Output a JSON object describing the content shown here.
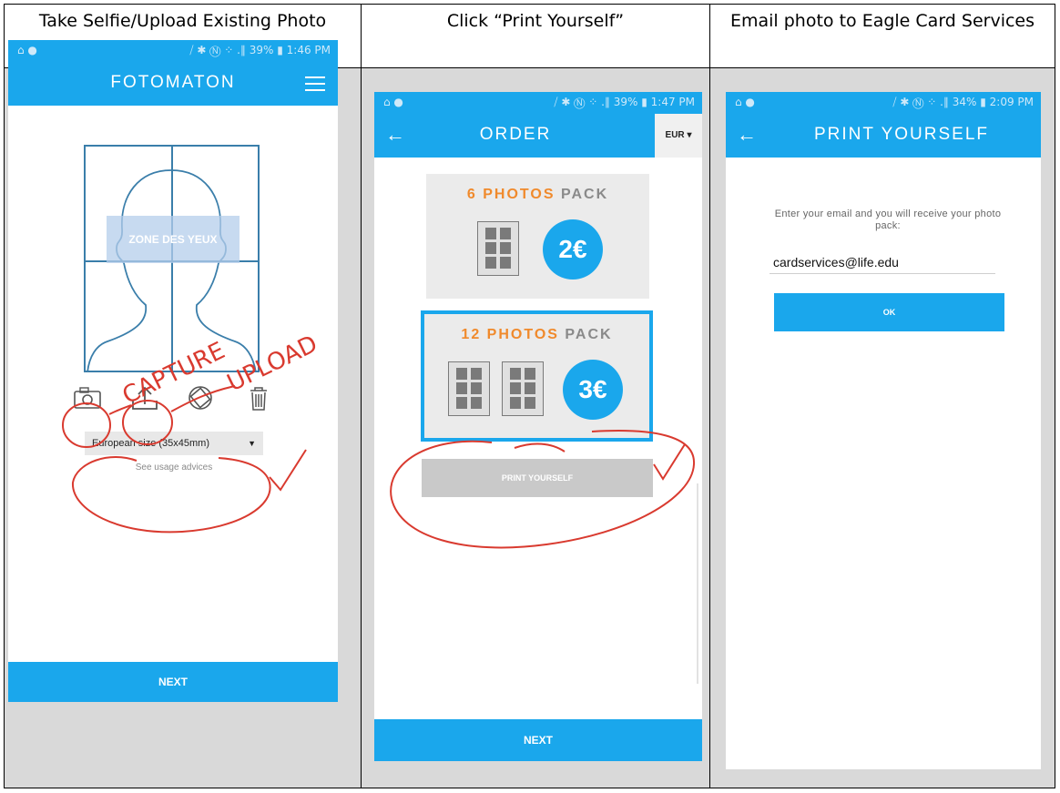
{
  "columns": [
    {
      "heading": "Take Selfie/Upload Existing Photo"
    },
    {
      "heading": "Click “Print Yourself”"
    },
    {
      "heading": "Email photo to Eagle Card Services"
    }
  ],
  "status_bars": [
    {
      "left": "⌂ ●",
      "right": "⧸ ✱ Ⓝ ⁘ .∥ 39% ▮ 1:46 PM"
    },
    {
      "left": "⌂ ●",
      "right": "⧸ ✱ Ⓝ ⁘ .∥ 39% ▮ 1:47 PM"
    },
    {
      "left": "⌂ ●",
      "right": "⧸ ✱ Ⓝ ⁘ .∥ 34% ▮ 2:09 PM"
    }
  ],
  "screen1": {
    "title": "FOTOMATON",
    "eye_zone": "ZONE DES YEUX",
    "tools": [
      "camera-icon",
      "upload-icon",
      "rotate-icon",
      "trash-icon"
    ],
    "size_value": "European size (35x45mm)",
    "usage_link": "See usage advices",
    "next": "NEXT",
    "annotations": {
      "capture": "CAPTURE",
      "upload": "UPLOAD"
    }
  },
  "screen2": {
    "title": "ORDER",
    "back": "←",
    "currency": "EUR",
    "currency_caret": "▾",
    "packs": [
      {
        "count": "6",
        "label": "PHOTOS",
        "suffix": "PACK",
        "price": "2€"
      },
      {
        "count": "12",
        "label": "PHOTOS",
        "suffix": "PACK",
        "price": "3€"
      }
    ],
    "print_button": "PRINT YOURSELF",
    "next": "NEXT"
  },
  "screen3": {
    "title": "PRINT YOURSELF",
    "back": "←",
    "prompt": "Enter your email and you will receive your photo pack:",
    "email_value": "cardservices@life.edu",
    "ok": "OK"
  },
  "colors": {
    "accent": "#1aa7ec",
    "orange": "#f08a2c",
    "annotation": "#d93a2f",
    "cell_bg": "#d9d9d9"
  }
}
